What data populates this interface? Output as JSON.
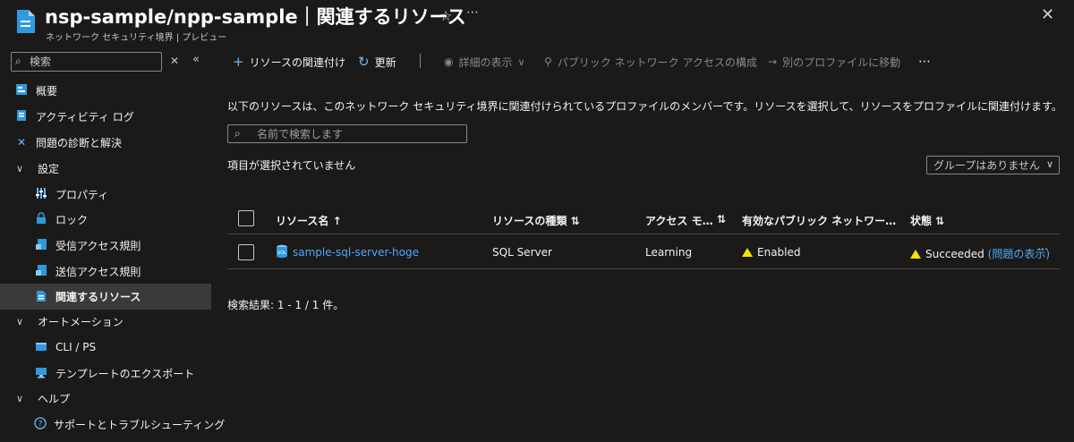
{
  "header": {
    "title": "nsp-sample/npp-sample｜関連するリソース",
    "subtitle": "ネットワーク セキュリティ境界 | プレビュー"
  },
  "sidebar": {
    "search_placeholder": "検索",
    "items": [
      {
        "label": "概要",
        "icon": "overview-icon"
      },
      {
        "label": "アクティビティ ログ",
        "icon": "activity-log-icon"
      },
      {
        "label": "問題の診断と解決",
        "icon": "wrench-icon"
      },
      {
        "label": "設定",
        "group": true
      },
      {
        "label": "プロパティ",
        "icon": "properties-icon"
      },
      {
        "label": "ロック",
        "icon": "lock-icon"
      },
      {
        "label": "受信アクセス規則",
        "icon": "inbound-rules-icon"
      },
      {
        "label": "送信アクセス規則",
        "icon": "outbound-rules-icon"
      },
      {
        "label": "関連するリソース",
        "icon": "associated-resources-icon",
        "selected": true
      },
      {
        "label": "オートメーション",
        "group": true
      },
      {
        "label": "CLI / PS",
        "icon": "cli-icon"
      },
      {
        "label": "テンプレートのエクスポート",
        "icon": "export-template-icon"
      },
      {
        "label": "ヘルプ",
        "group": true
      },
      {
        "label": "サポートとトラブルシューティング",
        "icon": "help-icon"
      }
    ]
  },
  "toolbar": {
    "associate": "リソースの関連付け",
    "refresh": "更新",
    "details": "詳細の表示",
    "configure_public": "パブリック ネットワーク アクセスの構成",
    "move_profile": "別のプロファイルに移動"
  },
  "main": {
    "description": "以下のリソースは、このネットワーク セキュリティ境界に関連付けられているプロファイルのメンバーです。リソースを選択して、リソースをプロファイルに関連付けます。",
    "filter_placeholder": "名前で検索します",
    "selection_status": "項目が選択されていません",
    "group_by": "グループはありません",
    "result_count": "検索結果: 1 - 1 / 1 件。"
  },
  "table": {
    "columns": [
      "リソース名 ↑",
      "リソースの種類 ⇅",
      "アクセス モ…",
      "⇅",
      "有効なパブリック ネットワー…",
      "状態 ⇅"
    ],
    "rows": [
      {
        "name": "sample-sql-server-hoge",
        "type": "SQL Server",
        "access_mode": "Learning",
        "public_access": "Enabled",
        "state": "Succeeded",
        "state_link": "(問題の表示)"
      }
    ]
  },
  "colors": {
    "background": "#1b1a19",
    "link": "#4fa8ff",
    "warning": "#fce100",
    "accent": "#4fa8ff"
  }
}
